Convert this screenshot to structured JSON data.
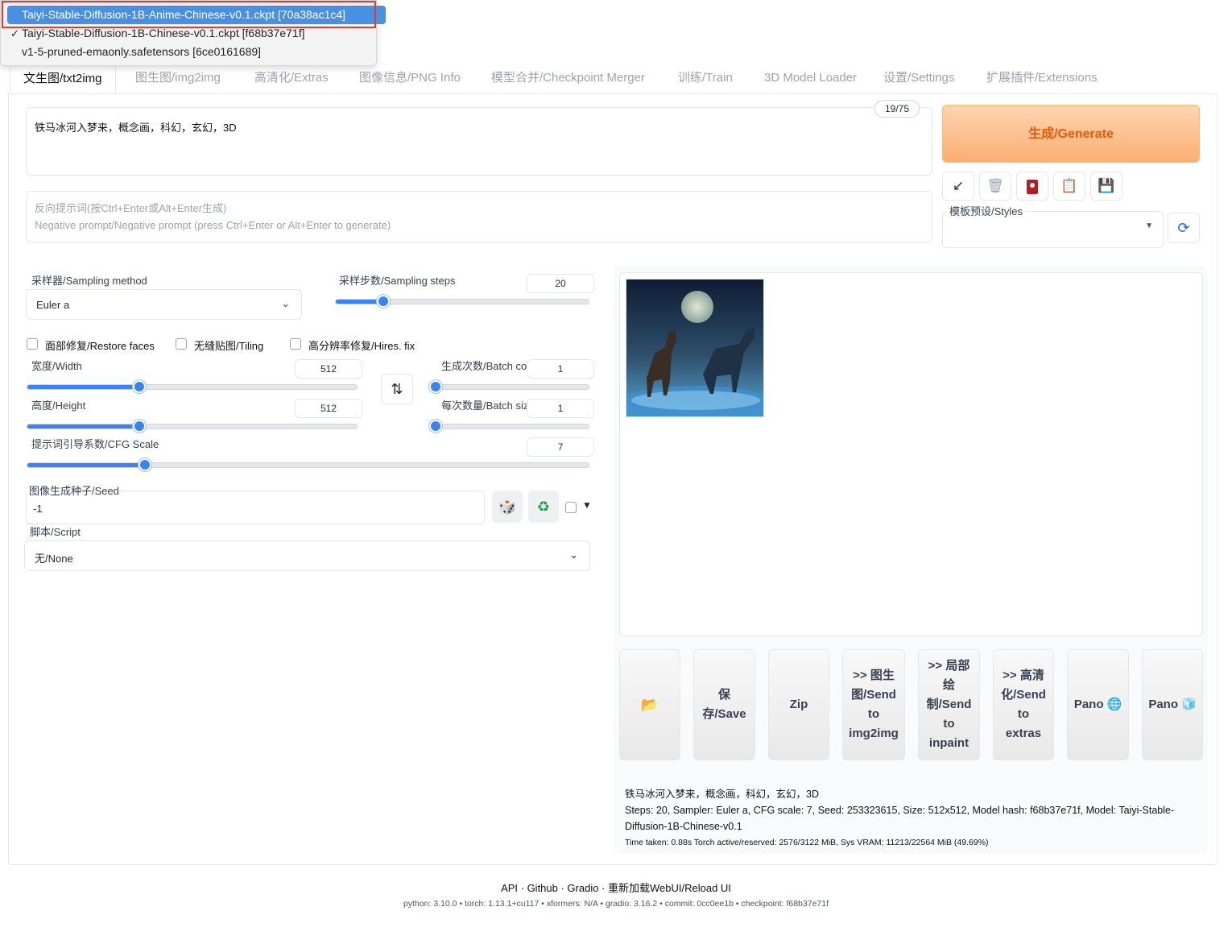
{
  "checkpoint_menu": {
    "items": [
      {
        "label": "Taiyi-Stable-Diffusion-1B-Anime-Chinese-v0.1.ckpt [70a38ac1c4]",
        "state": "highlighted"
      },
      {
        "label": "Taiyi-Stable-Diffusion-1B-Chinese-v0.1.ckpt [f68b37e71f]",
        "state": "checked"
      },
      {
        "label": "v1-5-pruned-emaonly.safetensors [6ce0161689]",
        "state": "normal"
      }
    ],
    "check_mark": "✓",
    "highlight_color": "#e53935"
  },
  "tabs": [
    {
      "label": "文生图/txt2img",
      "active": true
    },
    {
      "label": "图生图/img2img"
    },
    {
      "label": "高清化/Extras"
    },
    {
      "label": "图像信息/PNG Info"
    },
    {
      "label": "模型合并/Checkpoint Merger"
    },
    {
      "label": "训练/Train"
    },
    {
      "label": "3D Model Loader"
    },
    {
      "label": "设置/Settings"
    },
    {
      "label": "扩展插件/Extensions"
    }
  ],
  "prompt": {
    "value": "铁马冰河入梦来，概念画，科幻，玄幻，3D",
    "token_count": "19/75"
  },
  "negative_prompt": {
    "placeholder_line1": "反向提示词(按Ctrl+Enter或Alt+Enter生成)",
    "placeholder_line2": "Negative prompt/Negative prompt (press Ctrl+Enter or Alt+Enter to generate)"
  },
  "generate": {
    "label": "生成/Generate",
    "color": "#ea580c"
  },
  "toolbar_icons": [
    "arrow-down-left-icon",
    "trash-icon",
    "red-card-icon",
    "clipboard-icon",
    "save-disk-icon"
  ],
  "styles": {
    "label": "模板预设/Styles",
    "value": ""
  },
  "sampling": {
    "method_label": "采样器/Sampling method",
    "method_value": "Euler a",
    "steps_label": "采样步数/Sampling steps",
    "steps_value": "20",
    "steps_fraction": 0.19
  },
  "checkboxes": {
    "restore_faces": "面部修复/Restore faces",
    "tiling": "无缝贴图/Tiling",
    "hires_fix": "高分辨率修复/Hires. fix"
  },
  "width": {
    "label": "宽度/Width",
    "value": "512",
    "fraction": 0.34
  },
  "height": {
    "label": "高度/Height",
    "value": "512",
    "fraction": 0.34
  },
  "batch_count": {
    "label": "生成次数/Batch count",
    "value": "1",
    "fraction": 0.0
  },
  "batch_size": {
    "label": "每次数量/Batch size",
    "value": "1",
    "fraction": 0.0
  },
  "cfg": {
    "label": "提示词引导系数/CFG Scale",
    "value": "7",
    "fraction": 0.21
  },
  "seed": {
    "label": "图像生成种子/Seed",
    "value": "-1"
  },
  "script": {
    "label": "脚本/Script",
    "value": "无/None"
  },
  "actions": {
    "folder": "📂",
    "save": "保存/Save",
    "zip": "Zip",
    "send_img2img": ">> 图生图/Send to img2img",
    "send_inpaint": ">> 局部绘制/Send to inpaint",
    "send_extras": ">> 高清化/Send to extras",
    "pano1": "Pano",
    "pano2": "Pano"
  },
  "output_info": {
    "prompt": "铁马冰河入梦来，概念画，科幻，玄幻，3D",
    "params": "Steps: 20, Sampler: Euler a, CFG scale: 7, Seed: 253323615, Size: 512x512, Model hash: f68b37e71f, Model: Taiyi-Stable-Diffusion-1B-Chinese-v0.1",
    "timing": "Time taken: 0.88s  Torch active/reserved: 2576/3122 MiB, Sys VRAM: 11213/22564 MiB (49.69%)"
  },
  "footer": {
    "links": "API  ·  Github  ·  Gradio  ·  重新加载WebUI/Reload UI",
    "versions": "python: 3.10.0  •  torch: 1.13.1+cu117  •  xformers: N/A  •  gradio: 3.16.2  •  commit: 0cc0ee1b  •  checkpoint: f68b37e71f"
  }
}
